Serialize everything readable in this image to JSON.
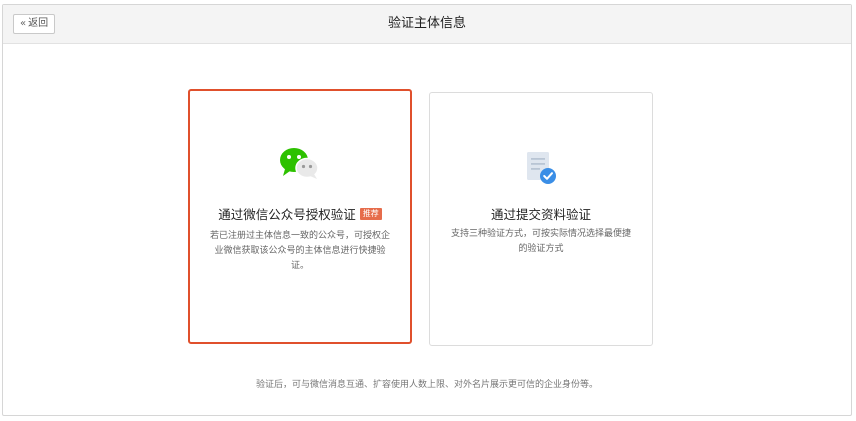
{
  "header": {
    "back_label": "返回",
    "title": "验证主体信息"
  },
  "options": [
    {
      "icon": "wechat-icon",
      "title": "通过微信公众号授权验证",
      "badge": "推荐",
      "desc": "若已注册过主体信息一致的公众号，可授权企业微信获取该公众号的主体信息进行快捷验证。",
      "selected": true
    },
    {
      "icon": "document-check-icon",
      "title": "通过提交资料验证",
      "desc": "支持三种验证方式，可按实际情况选择最便捷的验证方式",
      "selected": false
    }
  ],
  "footer_note": "验证后，可与微信消息互通、扩容使用人数上限、对外名片展示更可信的企业身份等。",
  "colors": {
    "selected_border": "#e0502c",
    "badge_bg": "#e66c4b",
    "wechat_green": "#2dc100",
    "doc_check_blue": "#3a8ee6"
  }
}
